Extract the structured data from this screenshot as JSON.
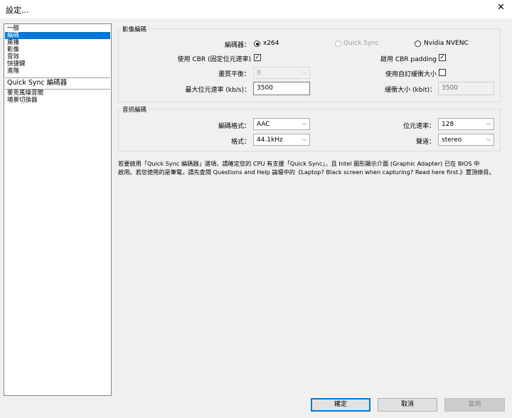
{
  "window": {
    "title": "設定..."
  },
  "sidebar": {
    "items": [
      "一般",
      "編碼",
      "廣播",
      "影像",
      "音效",
      "快捷鍵",
      "進階"
    ],
    "selected": "編碼",
    "plugin_items": [
      "Quick Sync 編碼器",
      "麥克風噪音閘",
      "場景切換器"
    ]
  },
  "video": {
    "group_title": "影像編碼",
    "encoder_label": "編碼器：",
    "encoder_options": [
      "x264",
      "Quick Sync",
      "Nvidia NVENC"
    ],
    "encoder_selected": "x264",
    "use_cbr_label": "使用 CBR (固定位元速率)",
    "use_cbr_checked": true,
    "enable_cbr_padding_label": "啟用 CBR padding",
    "enable_cbr_padding_checked": true,
    "quality_label": "畫質平衡：",
    "quality_value": "8",
    "custom_buffer_label": "使用自訂緩衝大小",
    "custom_buffer_checked": false,
    "max_bitrate_label": "最大位元速率 (kb/s)：",
    "max_bitrate_value": "3500",
    "buffer_size_label": "緩衝大小 (kbit)：",
    "buffer_size_value": "3500"
  },
  "audio": {
    "group_title": "音訊編碼",
    "codec_label": "編碼格式：",
    "codec_value": "AAC",
    "bitrate_label": "位元速率：",
    "bitrate_value": "128",
    "format_label": "格式：",
    "format_value": "44.1kHz",
    "channels_label": "聲道：",
    "channels_value": "stereo"
  },
  "note": {
    "line1": "若要啟用「Quick Sync 編碼器」選項，請確定您的 CPU 有支援「Quick Sync」，且 Intel 圖形顯示介面 (Graphic Adapter) 已在 BIOS 中",
    "line2": "啟用。若您使用的是筆電，請先查閱 Questions and Help 論壇中的《Laptop? Black screen when capturing? Read here first.》置頂條目。"
  },
  "buttons": {
    "ok": "確定",
    "cancel": "取消",
    "apply": "套用"
  },
  "icons": {
    "close": "close-icon",
    "dropdown": "chevron-down-icon"
  },
  "colors": {
    "selection": "#0078d7",
    "background": "#f0f0f0"
  }
}
